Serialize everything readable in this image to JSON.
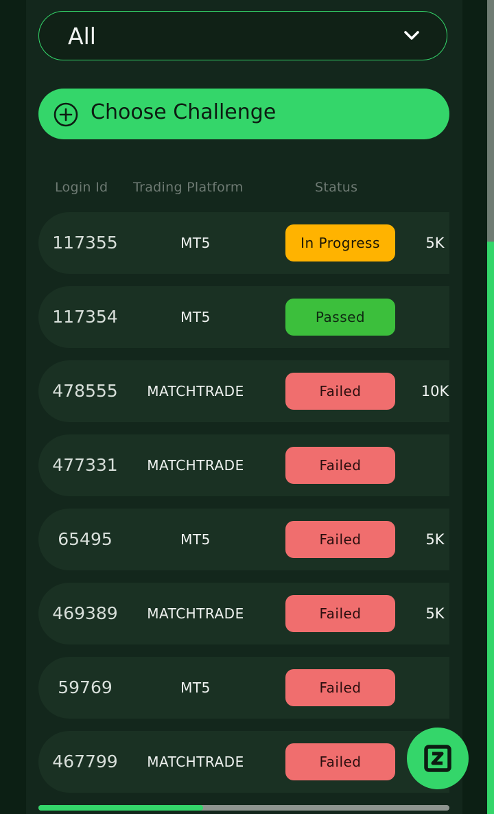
{
  "filter": {
    "selected": "All"
  },
  "cta": {
    "label": "Choose Challenge"
  },
  "table": {
    "headers": [
      "Login Id",
      "Trading Platform",
      "Status"
    ],
    "rows": [
      {
        "login_id": "117355",
        "platform": "MT5",
        "status": "In Progress",
        "status_kind": "progress",
        "amount": "5K"
      },
      {
        "login_id": "117354",
        "platform": "MT5",
        "status": "Passed",
        "status_kind": "passed",
        "amount": ""
      },
      {
        "login_id": "478555",
        "platform": "MATCHTRADE",
        "status": "Failed",
        "status_kind": "failed",
        "amount": "10K"
      },
      {
        "login_id": "477331",
        "platform": "MATCHTRADE",
        "status": "Failed",
        "status_kind": "failed",
        "amount": ""
      },
      {
        "login_id": "65495",
        "platform": "MT5",
        "status": "Failed",
        "status_kind": "failed",
        "amount": "5K"
      },
      {
        "login_id": "469389",
        "platform": "MATCHTRADE",
        "status": "Failed",
        "status_kind": "failed",
        "amount": "5K"
      },
      {
        "login_id": "59769",
        "platform": "MT5",
        "status": "Failed",
        "status_kind": "failed",
        "amount": ""
      },
      {
        "login_id": "467799",
        "platform": "MATCHTRADE",
        "status": "Failed",
        "status_kind": "failed",
        "amount": ""
      }
    ]
  },
  "colors": {
    "accent": "#34d66a",
    "progress": "#ffb300",
    "passed": "#3cbf3c",
    "failed": "#f06e6e"
  },
  "icons": {
    "dropdown": "chevron-down-icon",
    "cta": "plus-circle-icon",
    "fab": "brand-logo-icon"
  }
}
